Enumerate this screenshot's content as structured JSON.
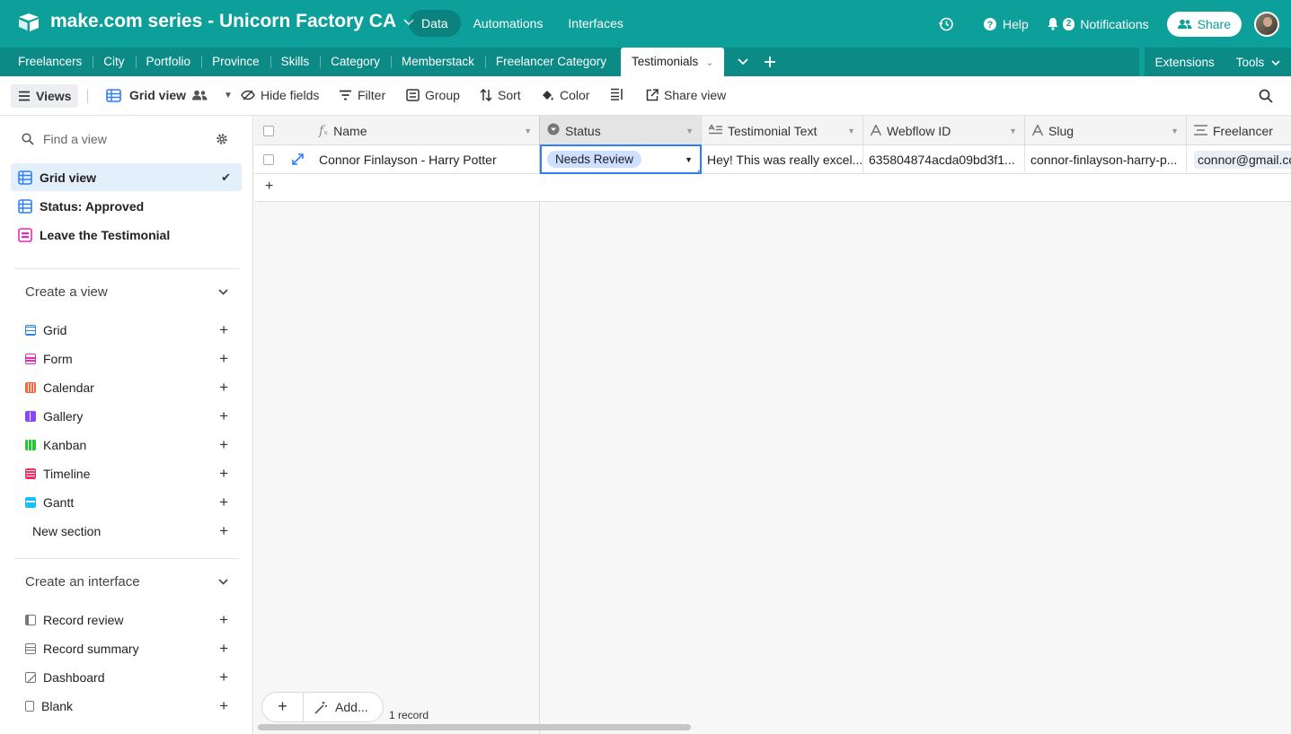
{
  "app": {
    "base_name": "make.com series - Unicorn Factory CA",
    "nav": [
      "Data",
      "Automations",
      "Interfaces"
    ],
    "help": "Help",
    "notifications_count": "2",
    "notifications": "Notifications",
    "share": "Share",
    "brand_color": "#0d9f9a"
  },
  "tabs": {
    "items": [
      "Freelancers",
      "City",
      "Portfolio",
      "Province",
      "Skills",
      "Category",
      "Memberstack",
      "Freelancer Category",
      "Testimonials"
    ],
    "active": "Testimonials",
    "extensions": "Extensions",
    "tools": "Tools"
  },
  "toolbar": {
    "views": "Views",
    "grid_view": "Grid view",
    "hide_fields": "Hide fields",
    "filter": "Filter",
    "group": "Group",
    "sort": "Sort",
    "color": "Color",
    "share_view": "Share view"
  },
  "sidebar": {
    "find_placeholder": "Find a view",
    "views": [
      {
        "label": "Grid view",
        "icon": "grid-icon",
        "selected": true
      },
      {
        "label": "Status: Approved",
        "icon": "grid-icon",
        "selected": false
      },
      {
        "label": "Leave the Testimonial",
        "icon": "form-icon",
        "selected": false
      }
    ],
    "create_view_title": "Create a view",
    "create_view": [
      {
        "label": "Grid",
        "icon": "grid-icon",
        "color": "#2d7ff9"
      },
      {
        "label": "Form",
        "icon": "form-icon",
        "color": "#e929ba"
      },
      {
        "label": "Calendar",
        "icon": "calendar-icon",
        "color": "#f7653b"
      },
      {
        "label": "Gallery",
        "icon": "gallery-icon",
        "color": "#8b46ff"
      },
      {
        "label": "Kanban",
        "icon": "kanban-icon",
        "color": "#20c933"
      },
      {
        "label": "Timeline",
        "icon": "timeline-icon",
        "color": "#f82b60"
      },
      {
        "label": "Gantt",
        "icon": "gantt-icon",
        "color": "#18bfff"
      }
    ],
    "new_section": "New section",
    "create_interface_title": "Create an interface",
    "create_interface": [
      {
        "label": "Record review",
        "icon": "record-review-icon"
      },
      {
        "label": "Record summary",
        "icon": "record-summary-icon"
      },
      {
        "label": "Dashboard",
        "icon": "dashboard-icon"
      },
      {
        "label": "Blank",
        "icon": "blank-icon"
      }
    ]
  },
  "grid": {
    "columns": [
      "Name",
      "Status",
      "Testimonial Text",
      "Webflow ID",
      "Slug",
      "Freelancer"
    ],
    "row": {
      "name": "Connor Finlayson - Harry Potter",
      "status": "Needs Review",
      "testimonial": "Hey! This was really excel...",
      "webflow_id": "635804874acda09bd3f1...",
      "slug": "connor-finlayson-harry-p...",
      "freelancer": "connor@gmail.com"
    },
    "add_label": "Add...",
    "record_count": "1 record"
  }
}
